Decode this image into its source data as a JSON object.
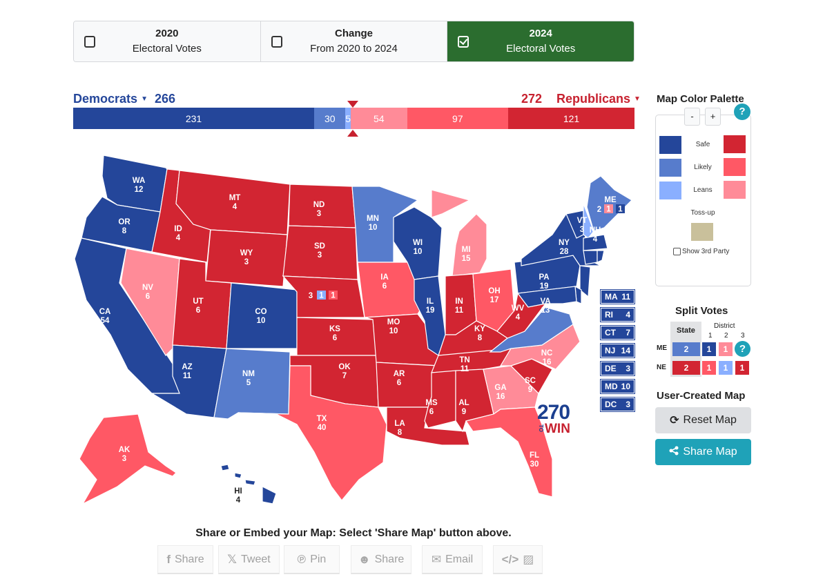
{
  "tabs": [
    {
      "title": "2020",
      "subtitle": "Electoral Votes",
      "checked": false
    },
    {
      "title": "Change",
      "subtitle": "From 2020 to 2024",
      "checked": false
    },
    {
      "title": "2024",
      "subtitle": "Electoral Votes",
      "checked": true
    }
  ],
  "tally": {
    "dem_label": "Democrats",
    "dem_total": "266",
    "rep_total": "272",
    "rep_label": "Republicans",
    "caret": "▼"
  },
  "bar_segments": [
    {
      "name": "dem-safe",
      "value": 231,
      "label": "231",
      "color": "#24469a"
    },
    {
      "name": "dem-likely",
      "value": 30,
      "label": "30",
      "color": "#577ccc"
    },
    {
      "name": "dem-leans",
      "value": 5,
      "label": "5",
      "color": "#8aafff"
    },
    {
      "name": "rep-leans",
      "value": 54,
      "label": "54",
      "color": "#ff8b98"
    },
    {
      "name": "rep-likely",
      "value": 97,
      "label": "97",
      "color": "#ff5865"
    },
    {
      "name": "rep-safe",
      "value": 121,
      "label": "121",
      "color": "#d22532"
    }
  ],
  "colors": {
    "dem_safe": "#24469a",
    "dem_likely": "#577ccc",
    "dem_leans": "#8aafff",
    "rep_safe": "#d22532",
    "rep_likely": "#ff5865",
    "rep_leans": "#ff8b98",
    "tossup": "#c9c09b",
    "teal": "#1fa2b8",
    "active_tab": "#2b6d2f"
  },
  "states": {
    "WA": {
      "ev": "12",
      "rating": "dem_safe"
    },
    "OR": {
      "ev": "8",
      "rating": "dem_safe"
    },
    "CA": {
      "ev": "54",
      "rating": "dem_safe"
    },
    "NV": {
      "ev": "6",
      "rating": "rep_leans"
    },
    "ID": {
      "ev": "4",
      "rating": "rep_safe"
    },
    "MT": {
      "ev": "4",
      "rating": "rep_safe"
    },
    "WY": {
      "ev": "3",
      "rating": "rep_safe"
    },
    "UT": {
      "ev": "6",
      "rating": "rep_safe"
    },
    "AZ": {
      "ev": "11",
      "rating": "dem_safe"
    },
    "CO": {
      "ev": "10",
      "rating": "dem_safe"
    },
    "NM": {
      "ev": "5",
      "rating": "dem_likely"
    },
    "ND": {
      "ev": "3",
      "rating": "rep_safe"
    },
    "SD": {
      "ev": "3",
      "rating": "rep_safe"
    },
    "NE": {
      "ev": "3",
      "rating": "rep_safe"
    },
    "KS": {
      "ev": "6",
      "rating": "rep_safe"
    },
    "OK": {
      "ev": "7",
      "rating": "rep_safe"
    },
    "TX": {
      "ev": "40",
      "rating": "rep_likely"
    },
    "MN": {
      "ev": "10",
      "rating": "dem_likely"
    },
    "IA": {
      "ev": "6",
      "rating": "rep_likely"
    },
    "MO": {
      "ev": "10",
      "rating": "rep_safe"
    },
    "AR": {
      "ev": "6",
      "rating": "rep_safe"
    },
    "LA": {
      "ev": "8",
      "rating": "rep_safe"
    },
    "WI": {
      "ev": "10",
      "rating": "dem_safe"
    },
    "IL": {
      "ev": "19",
      "rating": "dem_safe"
    },
    "MI": {
      "ev": "15",
      "rating": "rep_leans"
    },
    "IN": {
      "ev": "11",
      "rating": "rep_safe"
    },
    "OH": {
      "ev": "17",
      "rating": "rep_likely"
    },
    "KY": {
      "ev": "8",
      "rating": "rep_safe"
    },
    "TN": {
      "ev": "11",
      "rating": "rep_safe"
    },
    "MS": {
      "ev": "6",
      "rating": "rep_safe"
    },
    "AL": {
      "ev": "9",
      "rating": "rep_safe"
    },
    "GA": {
      "ev": "16",
      "rating": "rep_leans"
    },
    "FL": {
      "ev": "30",
      "rating": "rep_likely"
    },
    "SC": {
      "ev": "9",
      "rating": "rep_safe"
    },
    "NC": {
      "ev": "16",
      "rating": "rep_leans"
    },
    "VA": {
      "ev": "13",
      "rating": "dem_likely"
    },
    "WV": {
      "ev": "4",
      "rating": "rep_safe"
    },
    "PA": {
      "ev": "19",
      "rating": "dem_safe"
    },
    "NY": {
      "ev": "28",
      "rating": "dem_safe"
    },
    "VT": {
      "ev": "3",
      "rating": "dem_safe"
    },
    "NH": {
      "ev": "4",
      "rating": "dem_leans"
    },
    "ME": {
      "ev": "2",
      "rating": "dem_likely"
    },
    "AK": {
      "ev": "3",
      "rating": "rep_likely"
    },
    "HI": {
      "ev": "4",
      "rating": "dem_safe"
    }
  },
  "small_states": [
    {
      "abbr": "MA",
      "ev": "11"
    },
    {
      "abbr": "RI",
      "ev": "4"
    },
    {
      "abbr": "CT",
      "ev": "7"
    },
    {
      "abbr": "NJ",
      "ev": "14"
    },
    {
      "abbr": "DE",
      "ev": "3"
    },
    {
      "abbr": "MD",
      "ev": "10"
    },
    {
      "abbr": "DC",
      "ev": "3"
    }
  ],
  "map_districts": {
    "ME": {
      "statewide": "2",
      "d1": "1",
      "d2": "1"
    },
    "NE": {
      "statewide": "3",
      "d2": "1",
      "d3": "1"
    }
  },
  "logo": {
    "number": "270",
    "to": "TO",
    "win": "WIN"
  },
  "palette": {
    "title": "Map Color Palette",
    "minus": "-",
    "plus": "+",
    "help": "?",
    "safe": "Safe",
    "likely": "Likely",
    "leans": "Leans",
    "tossup": "Toss-up",
    "third_party": "Show 3rd Party"
  },
  "split_votes": {
    "title": "Split Votes",
    "state_header": "State",
    "district_header": "District",
    "district_numbers": [
      "1",
      "2",
      "3"
    ],
    "rows": [
      {
        "state": "ME",
        "statewide": "2",
        "districts": [
          "1",
          "1",
          "?"
        ]
      },
      {
        "state": "NE",
        "statewide": "2",
        "districts": [
          "1",
          "1",
          "1"
        ]
      }
    ]
  },
  "user_map": {
    "title": "User-Created Map",
    "reset": "Reset Map",
    "share": "Share Map"
  },
  "embed": {
    "title": "Share or Embed your Map: Select 'Share Map' button above.",
    "buttons": [
      {
        "icon": "f",
        "label": "Share"
      },
      {
        "icon": "𝕏",
        "label": "Tweet"
      },
      {
        "icon": "℗",
        "label": "Pin"
      },
      {
        "icon": "☻",
        "label": "Share"
      },
      {
        "icon": "✉",
        "label": "Email"
      },
      {
        "icon": "</>",
        "label": "▨"
      }
    ]
  }
}
